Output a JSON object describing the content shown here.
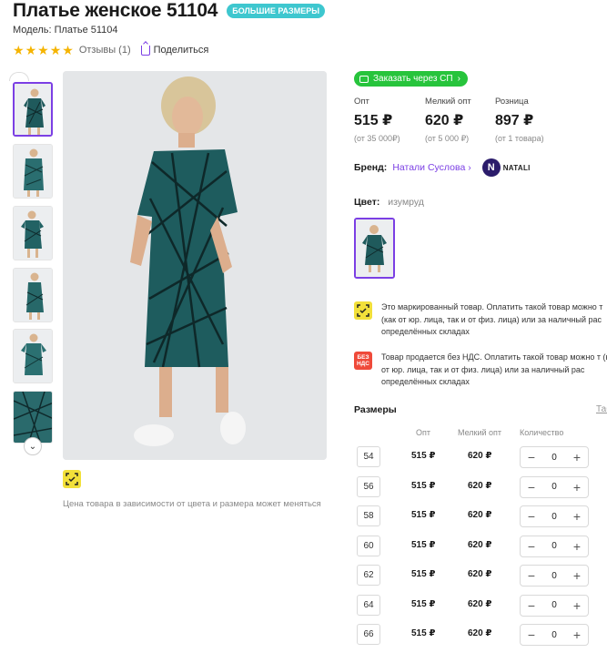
{
  "header": {
    "title": "Платье женское 51104",
    "badge": "БОЛЬШИЕ РАЗМЕРЫ",
    "model": "Модель: Платье 51104",
    "reviews": "Отзывы (1)",
    "share": "Поделиться",
    "rating_stars": 5
  },
  "gallery": {
    "thumb_count": 6,
    "active_index": 0,
    "price_note": "Цена товара в зависимости от цвета и размера может меняться"
  },
  "order_button": {
    "label": "Заказать через СП"
  },
  "prices": [
    {
      "label": "Опт",
      "value": "515 ₽",
      "sub": "(от 35 000₽)"
    },
    {
      "label": "Мелкий опт",
      "value": "620 ₽",
      "sub": "(от 5 000 ₽)"
    },
    {
      "label": "Розница",
      "value": "897 ₽",
      "sub": "(от 1 товара)"
    }
  ],
  "brand": {
    "label": "Бренд:",
    "name": "Натали Суслова",
    "logo_letter": "N",
    "logo_text": "NATALI"
  },
  "color": {
    "label": "Цвет:",
    "value": "изумруд"
  },
  "notices": [
    {
      "icon": "marking-icon",
      "text": "Это маркированный товар. Оплатить такой товар можно т (как от юр. лица, так и от физ. лица) или за наличный рас определённых складах"
    },
    {
      "icon": "no-vat-icon",
      "icon_text": "БЕЗ НДС",
      "text": "Товар продается без НДС. Оплатить такой товар можно т (как от юр. лица, так и от физ. лица) или за наличный рас определённых складах"
    }
  ],
  "sizes": {
    "title": "Размеры",
    "table_link": "Таб",
    "headers": {
      "opt": "Опт",
      "small_opt": "Мелкий опт",
      "quantity": "Количество"
    },
    "rows": [
      {
        "size": "54",
        "opt": "515 ₽",
        "small_opt": "620 ₽",
        "qty": "0"
      },
      {
        "size": "56",
        "opt": "515 ₽",
        "small_opt": "620 ₽",
        "qty": "0"
      },
      {
        "size": "58",
        "opt": "515 ₽",
        "small_opt": "620 ₽",
        "qty": "0"
      },
      {
        "size": "60",
        "opt": "515 ₽",
        "small_opt": "620 ₽",
        "qty": "0"
      },
      {
        "size": "62",
        "opt": "515 ₽",
        "small_opt": "620 ₽",
        "qty": "0"
      },
      {
        "size": "64",
        "opt": "515 ₽",
        "small_opt": "620 ₽",
        "qty": "0"
      },
      {
        "size": "66",
        "opt": "515 ₽",
        "small_opt": "620 ₽",
        "qty": "0"
      }
    ]
  },
  "colors": {
    "accent": "#7b3fe4",
    "order_green": "#27c43c",
    "badge_teal": "#3ec7cf",
    "star": "#f5b400",
    "marking_yellow": "#f2e03a",
    "nds_red": "#ef4a3a"
  }
}
